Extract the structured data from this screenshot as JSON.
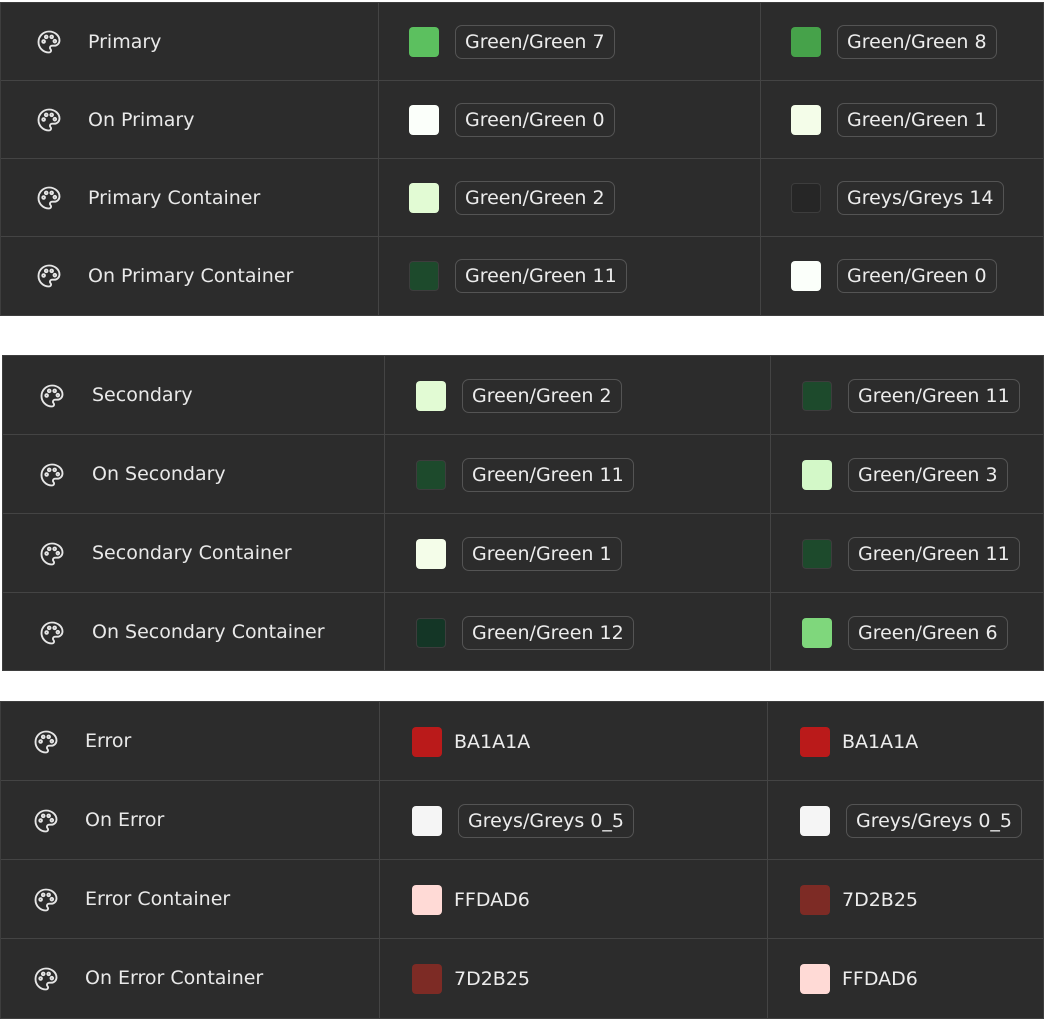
{
  "sections": [
    {
      "name": "primary",
      "rows": [
        {
          "label": "Primary",
          "light": {
            "color": "#5cc05f",
            "token": "Green/Green 7",
            "chip": true
          },
          "dark": {
            "color": "#46a24a",
            "token": "Green/Green 8",
            "chip": true
          }
        },
        {
          "label": "On Primary",
          "light": {
            "color": "#fbfffa",
            "token": "Green/Green 0",
            "chip": true
          },
          "dark": {
            "color": "#f4fde9",
            "token": "Green/Green 1",
            "chip": true
          }
        },
        {
          "label": "Primary Container",
          "light": {
            "color": "#e2fbd4",
            "token": "Green/Green 2",
            "chip": true
          },
          "dark": {
            "color": "#262626",
            "token": "Greys/Greys 14",
            "chip": true
          }
        },
        {
          "label": "On Primary Container",
          "light": {
            "color": "#1d4a2c",
            "token": "Green/Green 11",
            "chip": true
          },
          "dark": {
            "color": "#fbfffa",
            "token": "Green/Green 0",
            "chip": true
          }
        }
      ]
    },
    {
      "name": "secondary",
      "rows": [
        {
          "label": "Secondary",
          "light": {
            "color": "#e2fbd4",
            "token": "Green/Green 2",
            "chip": true
          },
          "dark": {
            "color": "#1d4a2c",
            "token": "Green/Green 11",
            "chip": true
          }
        },
        {
          "label": "On Secondary",
          "light": {
            "color": "#1d4a2c",
            "token": "Green/Green 11",
            "chip": true
          },
          "dark": {
            "color": "#d3f8c8",
            "token": "Green/Green 3",
            "chip": true
          }
        },
        {
          "label": "Secondary Container",
          "light": {
            "color": "#f4fde9",
            "token": "Green/Green 1",
            "chip": true
          },
          "dark": {
            "color": "#1d4a2c",
            "token": "Green/Green 11",
            "chip": true
          }
        },
        {
          "label": "On Secondary Container",
          "light": {
            "color": "#143626",
            "token": "Green/Green 12",
            "chip": true
          },
          "dark": {
            "color": "#7fd77c",
            "token": "Green/Green 6",
            "chip": true
          }
        }
      ]
    },
    {
      "name": "error",
      "rows": [
        {
          "label": "Error",
          "light": {
            "color": "#BA1A1A",
            "token": "BA1A1A",
            "chip": false
          },
          "dark": {
            "color": "#BA1A1A",
            "token": "BA1A1A",
            "chip": false
          }
        },
        {
          "label": "On Error",
          "light": {
            "color": "#f5f5f5",
            "token": "Greys/Greys 0_5",
            "chip": true
          },
          "dark": {
            "color": "#f5f5f5",
            "token": "Greys/Greys 0_5",
            "chip": true
          }
        },
        {
          "label": "Error Container",
          "light": {
            "color": "#FFDAD6",
            "token": "FFDAD6",
            "chip": false
          },
          "dark": {
            "color": "#7D2B25",
            "token": "7D2B25",
            "chip": false
          }
        },
        {
          "label": "On Error Container",
          "light": {
            "color": "#7D2B25",
            "token": "7D2B25",
            "chip": false
          },
          "dark": {
            "color": "#FFDAD6",
            "token": "FFDAD6",
            "chip": false
          }
        }
      ]
    }
  ],
  "row_icon": "palette-icon"
}
